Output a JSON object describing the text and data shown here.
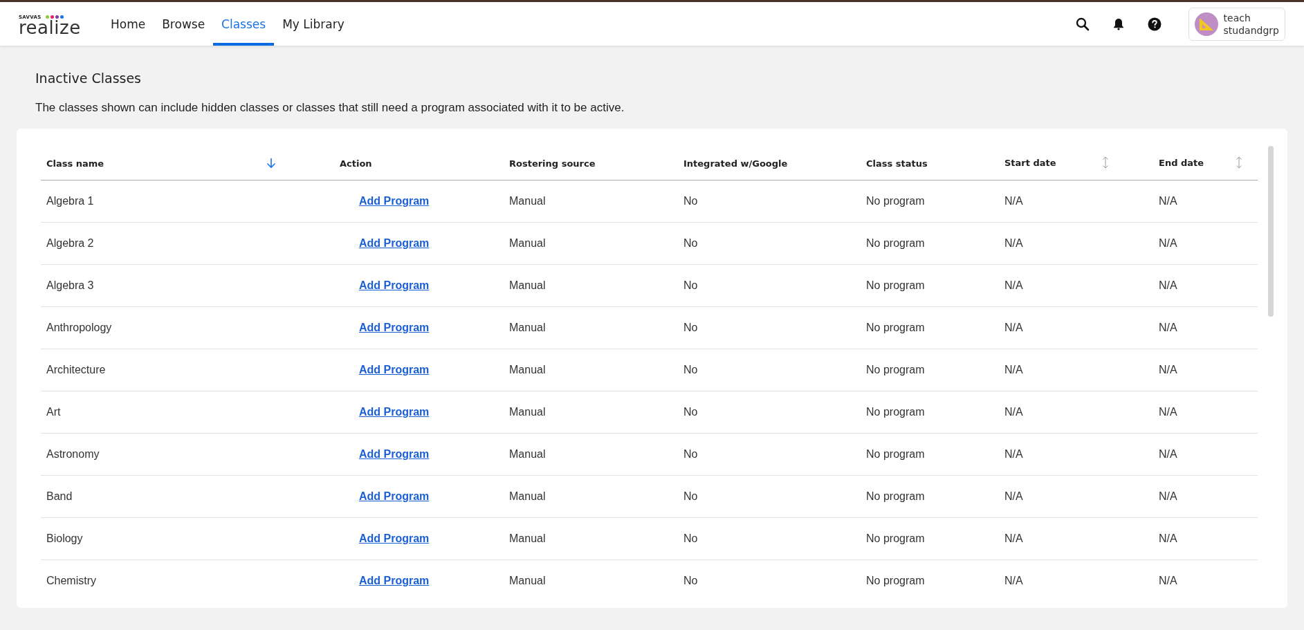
{
  "header": {
    "logo": {
      "small": "SAVVAS",
      "large": "realize",
      "dots": [
        {
          "color": "#8dc63f"
        },
        {
          "color": "#e0245e"
        },
        {
          "color": "#7b3fa0"
        },
        {
          "color": "#1a73e8"
        }
      ]
    },
    "nav": [
      {
        "label": "Home",
        "selected": false
      },
      {
        "label": "Browse",
        "selected": false
      },
      {
        "label": "Classes",
        "selected": true
      },
      {
        "label": "My Library",
        "selected": false
      }
    ],
    "user": {
      "first": "teach",
      "second": "studandgrp"
    }
  },
  "page": {
    "title": "Inactive Classes",
    "description": "The classes shown can include hidden classes or classes that still need a program associated with it to be active."
  },
  "table": {
    "columns": [
      {
        "label": "Class name",
        "sorted": true
      },
      {
        "label": "Action"
      },
      {
        "label": "Rostering source"
      },
      {
        "label": "Integrated w/Google"
      },
      {
        "label": "Class status"
      },
      {
        "label": "Start date",
        "sorted": false
      },
      {
        "label": "End date",
        "sorted": false
      }
    ],
    "rows": [
      {
        "name": "Algebra 1",
        "action": "Add Program",
        "source": "Manual",
        "google": "No",
        "status": "No program",
        "start": "N/A",
        "end": "N/A"
      },
      {
        "name": "Algebra 2",
        "action": "Add Program",
        "source": "Manual",
        "google": "No",
        "status": "No program",
        "start": "N/A",
        "end": "N/A"
      },
      {
        "name": "Algebra 3",
        "action": "Add Program",
        "source": "Manual",
        "google": "No",
        "status": "No program",
        "start": "N/A",
        "end": "N/A"
      },
      {
        "name": "Anthropology",
        "action": "Add Program",
        "source": "Manual",
        "google": "No",
        "status": "No program",
        "start": "N/A",
        "end": "N/A"
      },
      {
        "name": "Architecture",
        "action": "Add Program",
        "source": "Manual",
        "google": "No",
        "status": "No program",
        "start": "N/A",
        "end": "N/A"
      },
      {
        "name": "Art",
        "action": "Add Program",
        "source": "Manual",
        "google": "No",
        "status": "No program",
        "start": "N/A",
        "end": "N/A"
      },
      {
        "name": "Astronomy",
        "action": "Add Program",
        "source": "Manual",
        "google": "No",
        "status": "No program",
        "start": "N/A",
        "end": "N/A"
      },
      {
        "name": "Band",
        "action": "Add Program",
        "source": "Manual",
        "google": "No",
        "status": "No program",
        "start": "N/A",
        "end": "N/A"
      },
      {
        "name": "Biology",
        "action": "Add Program",
        "source": "Manual",
        "google": "No",
        "status": "No program",
        "start": "N/A",
        "end": "N/A"
      },
      {
        "name": "Chemistry",
        "action": "Add Program",
        "source": "Manual",
        "google": "No",
        "status": "No program",
        "start": "N/A",
        "end": "N/A"
      }
    ]
  }
}
